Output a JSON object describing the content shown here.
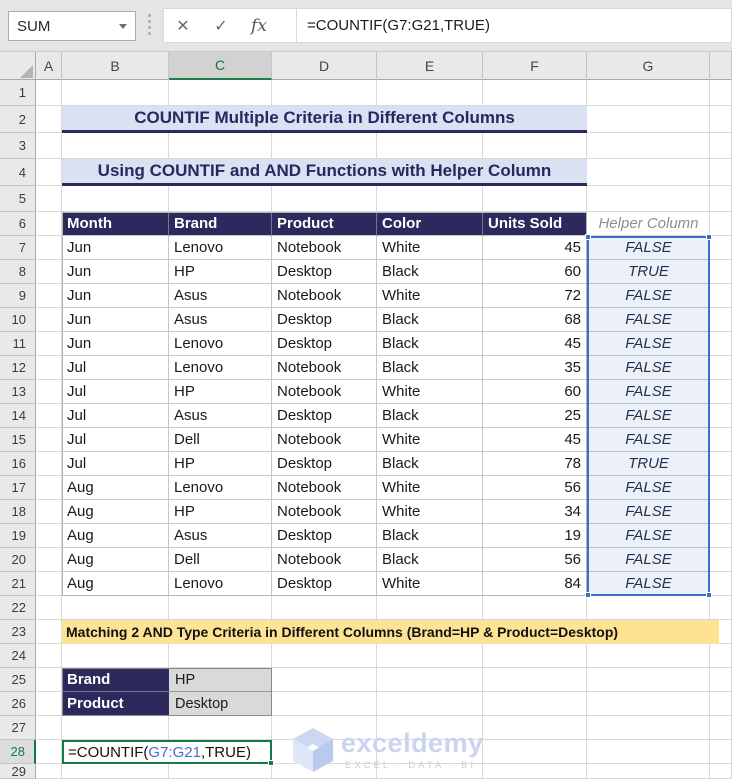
{
  "formula_bar": {
    "name_box_value": "SUM",
    "formula": "=COUNTIF(G7:G21,TRUE)",
    "cancel_icon": "✕",
    "enter_icon": "✓",
    "fx_icon": "fx"
  },
  "grid": {
    "column_headers": [
      "A",
      "B",
      "C",
      "D",
      "E",
      "F",
      "G"
    ],
    "selected_column": "C",
    "selected_row": "28",
    "row_numbers": [
      "1",
      "2",
      "3",
      "4",
      "5",
      "6",
      "7",
      "8",
      "9",
      "10",
      "11",
      "12",
      "13",
      "14",
      "15",
      "16",
      "17",
      "18",
      "19",
      "20",
      "21",
      "22",
      "23",
      "24",
      "25",
      "26",
      "27",
      "28",
      "29"
    ]
  },
  "titles": {
    "main": "COUNTIF Multiple Criteria in Different Columns",
    "sub": "Using COUNTIF and AND Functions with Helper Column"
  },
  "table": {
    "headers": [
      "Month",
      "Brand",
      "Product",
      "Color",
      "Units Sold"
    ],
    "helper_header": "Helper Column",
    "rows": [
      {
        "month": "Jun",
        "brand": "Lenovo",
        "product": "Notebook",
        "color": "White",
        "units": "45",
        "helper": "FALSE"
      },
      {
        "month": "Jun",
        "brand": "HP",
        "product": "Desktop",
        "color": "Black",
        "units": "60",
        "helper": "TRUE"
      },
      {
        "month": "Jun",
        "brand": "Asus",
        "product": "Notebook",
        "color": "White",
        "units": "72",
        "helper": "FALSE"
      },
      {
        "month": "Jun",
        "brand": "Asus",
        "product": "Desktop",
        "color": "Black",
        "units": "68",
        "helper": "FALSE"
      },
      {
        "month": "Jun",
        "brand": "Lenovo",
        "product": "Desktop",
        "color": "Black",
        "units": "45",
        "helper": "FALSE"
      },
      {
        "month": "Jul",
        "brand": "Lenovo",
        "product": "Notebook",
        "color": "Black",
        "units": "35",
        "helper": "FALSE"
      },
      {
        "month": "Jul",
        "brand": "HP",
        "product": "Notebook",
        "color": "White",
        "units": "60",
        "helper": "FALSE"
      },
      {
        "month": "Jul",
        "brand": "Asus",
        "product": "Desktop",
        "color": "Black",
        "units": "25",
        "helper": "FALSE"
      },
      {
        "month": "Jul",
        "brand": "Dell",
        "product": "Notebook",
        "color": "White",
        "units": "45",
        "helper": "FALSE"
      },
      {
        "month": "Jul",
        "brand": "HP",
        "product": "Desktop",
        "color": "Black",
        "units": "78",
        "helper": "TRUE"
      },
      {
        "month": "Aug",
        "brand": "Lenovo",
        "product": "Notebook",
        "color": "White",
        "units": "56",
        "helper": "FALSE"
      },
      {
        "month": "Aug",
        "brand": "HP",
        "product": "Notebook",
        "color": "White",
        "units": "34",
        "helper": "FALSE"
      },
      {
        "month": "Aug",
        "brand": "Asus",
        "product": "Desktop",
        "color": "Black",
        "units": "19",
        "helper": "FALSE"
      },
      {
        "month": "Aug",
        "brand": "Dell",
        "product": "Notebook",
        "color": "Black",
        "units": "56",
        "helper": "FALSE"
      },
      {
        "month": "Aug",
        "brand": "Lenovo",
        "product": "Desktop",
        "color": "White",
        "units": "84",
        "helper": "FALSE"
      }
    ]
  },
  "criteria_banner": "Matching 2 AND Type Criteria in Different Columns (Brand=HP & Product=Desktop)",
  "criteria": [
    {
      "label": "Brand",
      "value": "HP"
    },
    {
      "label": "Product",
      "value": "Desktop"
    }
  ],
  "result_formula": {
    "prefix": "=COUNTIF(",
    "range": "G7:G21",
    "suffix": ",TRUE)"
  },
  "watermark": {
    "brand": "exceldemy",
    "tagline": "EXCEL · DATA · BI"
  },
  "colors": {
    "header_navy": "#2c2a5c",
    "banner_lavender": "#d9e1f2",
    "selection_blue": "#3e6dc5",
    "selection_fill": "#e9eef8",
    "highlight_yellow": "#ffe394",
    "criteria_gray": "#d9d9d9",
    "excel_green": "#107c41",
    "reference_blue": "#4472c4"
  }
}
